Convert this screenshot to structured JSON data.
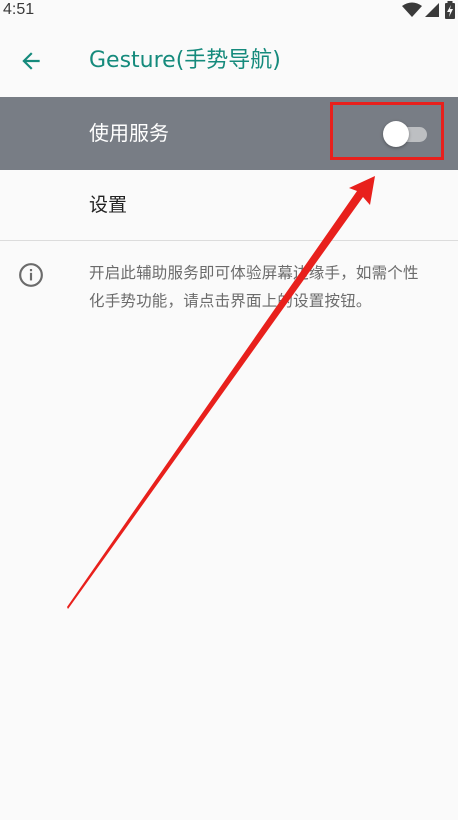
{
  "status_bar": {
    "time": "4:51",
    "icons": [
      "wifi-icon",
      "signal-icon",
      "battery-charging-icon"
    ]
  },
  "app_bar": {
    "back_icon": "arrow-back-icon",
    "title": "Gesture(手势导航)"
  },
  "use_service": {
    "label": "使用服务",
    "toggle_on": false
  },
  "settings": {
    "label": "设置"
  },
  "info": {
    "icon": "info-icon",
    "text": "开启此辅助服务即可体验屏幕边缘手，如需个性化手势功能，请点击界面上的设置按钮。"
  },
  "annotation": {
    "color": "#e8201c"
  },
  "colors": {
    "accent": "#158a7c",
    "highlight_row": "#787d85",
    "background": "#fafafa"
  }
}
